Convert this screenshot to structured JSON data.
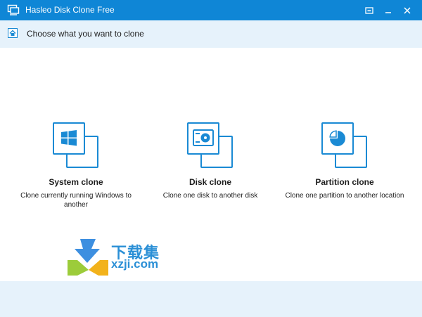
{
  "window": {
    "title": "Hasleo Disk Clone Free",
    "icons": {
      "app": "monitor-clone-icon",
      "menu": "menu-icon",
      "minimize": "minimize-icon",
      "close": "close-icon"
    }
  },
  "subheader": {
    "text": "Choose what you want to clone",
    "icon": "home-icon"
  },
  "options": [
    {
      "title": "System clone",
      "description": "Clone currently running Windows to another",
      "icon": "windows-icon"
    },
    {
      "title": "Disk clone",
      "description": "Clone one disk to another disk",
      "icon": "disk-icon"
    },
    {
      "title": "Partition clone",
      "description": "Clone one partition to another location",
      "icon": "partition-icon"
    }
  ],
  "watermark": {
    "chinese": "下载集",
    "url": "xzji.com"
  },
  "colors": {
    "accent": "#0f86d6",
    "icon_blue": "#1a8ad4",
    "light_panel": "#e6f2fb",
    "text": "#1e1e1e"
  }
}
